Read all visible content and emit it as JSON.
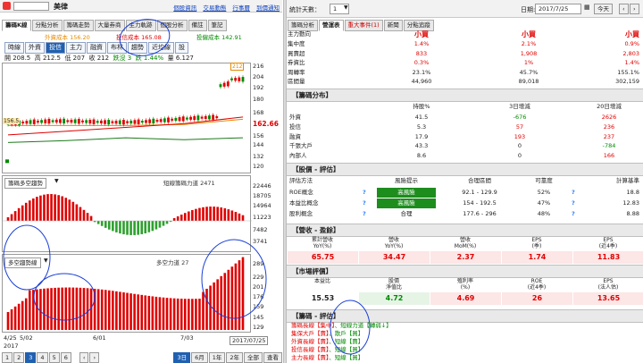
{
  "left": {
    "title": "美律",
    "top_links": [
      "個股資訊",
      "交易動態",
      "行事曆",
      "到價通知"
    ],
    "tabs": [
      "籌碼K線",
      "分點分析",
      "籌碼走勢",
      "大量券商",
      "主力軌跡",
      "個股分析",
      "備註",
      "筆記"
    ],
    "active_tab_index": 0,
    "cost_labels": {
      "foreign": "外資成本 156.20",
      "trust": "投信成本 165.08",
      "investor": "投僱成本 142.91"
    },
    "chart_buttons": [
      "時線",
      "外資",
      "投信",
      "主力",
      "融資",
      "布林",
      "趨勢",
      "近均線",
      "設"
    ],
    "active_chart_button_index": 2,
    "ohlc": {
      "open": "開 208.5",
      "high": "高 212.5",
      "low": "低 207",
      "close": "收 212",
      "change": "跌沒 3",
      "pct": "跌 1.44%",
      "volume": "量 6.127"
    },
    "price_axis": [
      "218",
      "216",
      "204",
      "192",
      "180",
      "168",
      "156",
      "144",
      "132",
      "120",
      "108"
    ],
    "price_tag_high": "212",
    "price_tag_now": "162.66",
    "price_tag_left": "156.5",
    "mid_selector": "籌碼多空趨勢",
    "mid_legend": "短線籌碼力道 2471",
    "mid_axis": [
      "22446",
      "18705",
      "14964",
      "11223",
      "7482",
      "3741",
      "0"
    ],
    "low_selector": "多空趨勢線",
    "low_legend": "多空力道 27",
    "low_axis": [
      "289",
      "229",
      "201",
      "176",
      "159",
      "145",
      "129"
    ],
    "date_axis": [
      "4/25",
      "5/02",
      "6/01",
      "7/03"
    ],
    "year_label": "2017",
    "cursor_date": "2017/07/25",
    "pages": [
      "1",
      "2",
      "3",
      "4",
      "5",
      "6"
    ],
    "range_buttons": [
      "3日",
      "6月",
      "1年",
      "2年",
      "全部",
      "查看"
    ],
    "active_range_index": 0,
    "bottom_buttons": [
      "‹",
      "›"
    ]
  },
  "right": {
    "stats_label": "統計天數：",
    "stats_value": "1",
    "date_label": "日期:",
    "date_value": "2017/7/25",
    "today_btn": "今天",
    "tabs": [
      "籌碼分析",
      "營運表",
      "重大事件(1)",
      "新聞",
      "分點追蹤"
    ],
    "active_tab_index": 1,
    "top_table": {
      "cols": [
        "主力動向",
        "小買",
        "小買",
        "小買"
      ],
      "rows": [
        {
          "label": "集中度",
          "values": [
            "1.4%",
            "2.1%",
            "0.9%"
          ],
          "cls": "red"
        },
        {
          "label": "買賣超",
          "values": [
            "833",
            "1,908",
            "2,803"
          ],
          "cls": "red"
        },
        {
          "label": "券資比",
          "values": [
            "0.3%",
            "1%",
            "1.4%"
          ],
          "cls": "red"
        },
        {
          "label": "周轉率",
          "values": [
            "23.1%",
            "45.7%",
            "155.1%"
          ],
          "cls": ""
        },
        {
          "label": "區間量",
          "values": [
            "44,960",
            "89,018",
            "302,159"
          ],
          "cls": ""
        }
      ]
    },
    "dist": {
      "title": "【籌碼分布】",
      "headers": [
        "持股%",
        "3日增減",
        "20日增減"
      ],
      "rows": [
        {
          "label": "外資",
          "v": [
            "41.5",
            "-676",
            "2626"
          ],
          "cls": [
            "",
            "green",
            "red"
          ]
        },
        {
          "label": "投信",
          "v": [
            "5.3",
            "57",
            "236"
          ],
          "cls": [
            "",
            "red",
            "red"
          ]
        },
        {
          "label": "融資",
          "v": [
            "17.9",
            "193",
            "237"
          ],
          "cls": [
            "",
            "red",
            "red"
          ]
        },
        {
          "label": "千張大戶",
          "v": [
            "43.3",
            "0",
            "-784"
          ],
          "cls": [
            "",
            "",
            "green"
          ]
        },
        {
          "label": "內部人",
          "v": [
            "8.6",
            "0",
            "166"
          ],
          "cls": [
            "",
            "",
            "red"
          ]
        }
      ]
    },
    "valuation": {
      "title": "【股價 - 評估】",
      "headers": [
        "評估方法",
        "風險提示",
        "合理區間",
        "可靠度",
        "計算基準"
      ],
      "rows": [
        {
          "label": "ROE概念",
          "risk": "高風險",
          "range": "92.1 - 129.9",
          "rel": "52%",
          "base": "18.8"
        },
        {
          "label": "本益比概念",
          "risk": "高風險",
          "range": "154 - 192.5",
          "rel": "47%",
          "base": "12.83"
        },
        {
          "label": "股利概念",
          "risk": "合理",
          "range": "177.6 - 296",
          "rel": "48%",
          "base": "8.88"
        }
      ]
    },
    "earnings": {
      "title": "【營收 - 盈餘】",
      "headers": [
        "累計營收\nYoY(%)",
        "營收\nYoY(%)",
        "營收\nMoM(%)",
        "EPS\n(季)",
        "EPS\n(近4季)"
      ],
      "values": [
        "65.75",
        "34.47",
        "2.37",
        "1.74",
        "11.83"
      ]
    },
    "market": {
      "title": "【市場評價】",
      "headers": [
        "本益比",
        "股價\n淨值比",
        "殖利率\n(%)",
        "ROE\n(近4季)",
        "EPS\n(法人估)"
      ],
      "values": [
        "15.53",
        "4.72",
        "4.69",
        "26",
        "13.65"
      ]
    },
    "chip_eval": {
      "title": "【籌碼 - 評估】",
      "lines": [
        {
          "a": "籌碼長線【集中】",
          "b": "、短線力道【轉弱↓】"
        },
        {
          "a": "集保大戶【賣】",
          "b": "、散戶【買】"
        },
        {
          "a": "外資長線【賣】",
          "b": "、短線【賣】"
        },
        {
          "a": "投信長線【賣】",
          "b": "、短線【買】"
        },
        {
          "a": "主力長線【賣】",
          "b": "、短線【買】"
        }
      ]
    }
  },
  "colors": {
    "accent": "#2060b0",
    "red": "#e00000",
    "green": "#008a00"
  },
  "chart_data": [
    {
      "type": "line",
      "x": [
        "4/25",
        "5/02",
        "6/01",
        "7/03",
        "7/25"
      ],
      "series": [
        {
          "name": "外資成本 156.20",
          "values": [
            156,
            156,
            156,
            157,
            162.66
          ]
        },
        {
          "name": "投信成本 165.08",
          "values": [
            146,
            150,
            154,
            158,
            165
          ]
        },
        {
          "name": "投僱成本 142.91",
          "values": [
            138,
            140,
            143,
            141,
            143
          ]
        }
      ],
      "ylim": [
        108,
        218
      ]
    },
    {
      "type": "bar",
      "x": [
        "4/25",
        "5/02",
        "6/01",
        "7/03",
        "7/25"
      ],
      "series": [
        {
          "name": "短線籌碼力道 2471",
          "values": [
            12000,
            17000,
            -6000,
            3000,
            2471
          ]
        }
      ],
      "ylim": [
        0,
        22446
      ]
    },
    {
      "type": "bar",
      "x": [
        "4/25",
        "5/02",
        "6/01",
        "7/03",
        "7/25"
      ],
      "series": [
        {
          "name": "多空力道 27",
          "values": [
            150,
            185,
            160,
            175,
            280
          ]
        }
      ],
      "ylim": [
        129,
        289
      ]
    }
  ]
}
